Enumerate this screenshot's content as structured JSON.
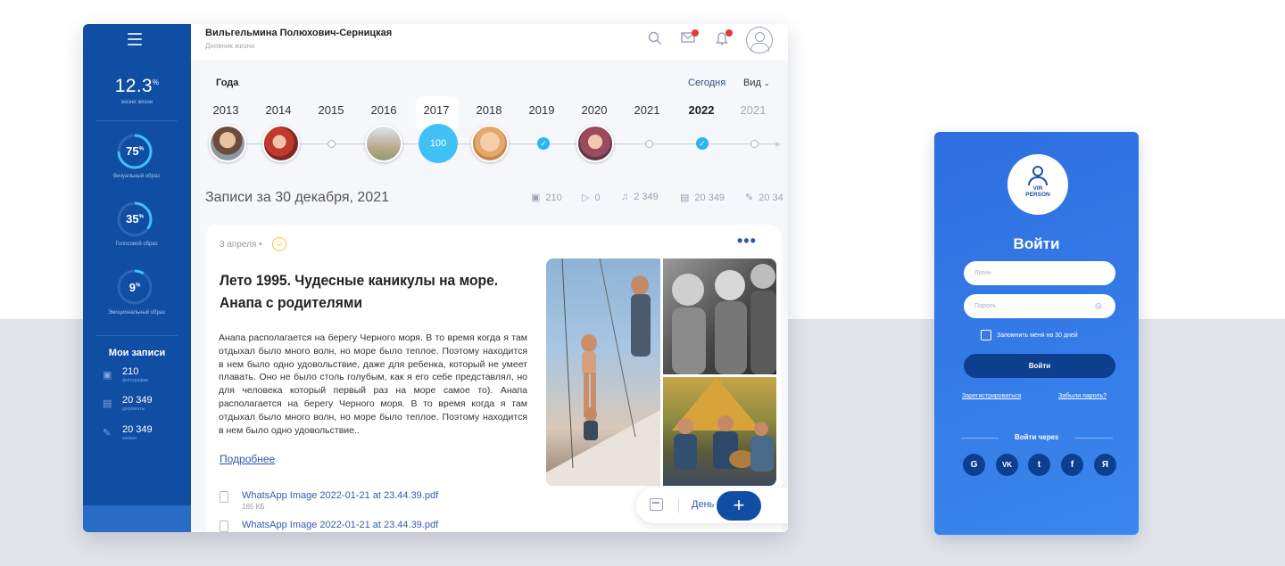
{
  "header": {
    "user_name": "Вильгельмина Полюхович-Серницкая",
    "subtitle": "Дневник жизни"
  },
  "sidebar": {
    "big_stat_value": "12.3",
    "big_stat_unit": "%",
    "big_stat_caption": "жизни жизни",
    "rings": [
      {
        "value": "75",
        "unit": "%",
        "caption": "Визуальный образ",
        "percent": 75
      },
      {
        "value": "35",
        "unit": "%",
        "caption": "Голосовой образ",
        "percent": 35
      },
      {
        "value": "9",
        "unit": "%",
        "caption": "Эмоциональный образ",
        "percent": 9
      }
    ],
    "records_title": "Мои записи",
    "records": [
      {
        "value": "210",
        "caption": "фотографии",
        "icon": "image-icon"
      },
      {
        "value": "20 349",
        "caption": "документы",
        "icon": "document-icon"
      },
      {
        "value": "20 349",
        "caption": "записи",
        "icon": "pencil-icon"
      }
    ]
  },
  "timeline": {
    "title": "Года",
    "today_label": "Сегодня",
    "view_label": "Вид",
    "years": [
      "2013",
      "2014",
      "2015",
      "2016",
      "2017",
      "2018",
      "2019",
      "2020",
      "2021",
      "2022",
      "2021"
    ],
    "active_year": "2022",
    "node_count_label": "100"
  },
  "records_bar": {
    "title": "Записи за 30 декабря, 2021",
    "stats": [
      {
        "icon": "image-icon",
        "value": "210"
      },
      {
        "icon": "play-icon",
        "value": "0"
      },
      {
        "icon": "music-icon",
        "value": "2 349"
      },
      {
        "icon": "document-icon",
        "value": "20 349"
      },
      {
        "icon": "pencil-icon",
        "value": "20 34"
      }
    ]
  },
  "post": {
    "date": "3 апреля •",
    "title_line1": "Лето 1995. Чудесные каникулы на море.",
    "title_line2": "Анапа с родителями",
    "text": "Анапа располагается на берегу Черного моря. В то время когда я там отдыхал было много волн, но море было теплое. Поэтому находится в нем было одно удовольствие, даже для ребенка, который не умеет плавать. Оно не было столь голубым, как я его себе представлял, но для человека который первый раз на море самое то). Анапа располагается на берегу Черного моря. В то время когда я там отдыхал было много волн, но море было теплое. Поэтому находится в нем было одно удовольствие..",
    "read_more": "Подробнее",
    "files": [
      {
        "name": "WhatsApp Image 2022-01-21 at 23.44.39.pdf",
        "size": "165 КБ"
      },
      {
        "name": "WhatsApp Image 2022-01-21 at 23.44.39.pdf",
        "size": ""
      }
    ]
  },
  "fab": {
    "day_label": "День",
    "plus_label": "+"
  },
  "login": {
    "logo_line1": "VIR",
    "logo_line2": "PERSON",
    "title": "Войти",
    "login_placeholder": "Логин",
    "password_placeholder": "Пароль",
    "remember_label": "Запомнить меня на 30 дней",
    "submit_label": "Войти",
    "register_link": "Зарегистрироваться",
    "forgot_link": "Забыли пароль?",
    "via_label": "Войти через",
    "socials": [
      "G",
      "VK",
      "t",
      "f",
      "Я"
    ]
  },
  "colors": {
    "sidebar": "#0f4ea3",
    "accent": "#3fc1f5",
    "login_bg": "#2e6fe0",
    "button_dark": "#0e3f8f"
  }
}
